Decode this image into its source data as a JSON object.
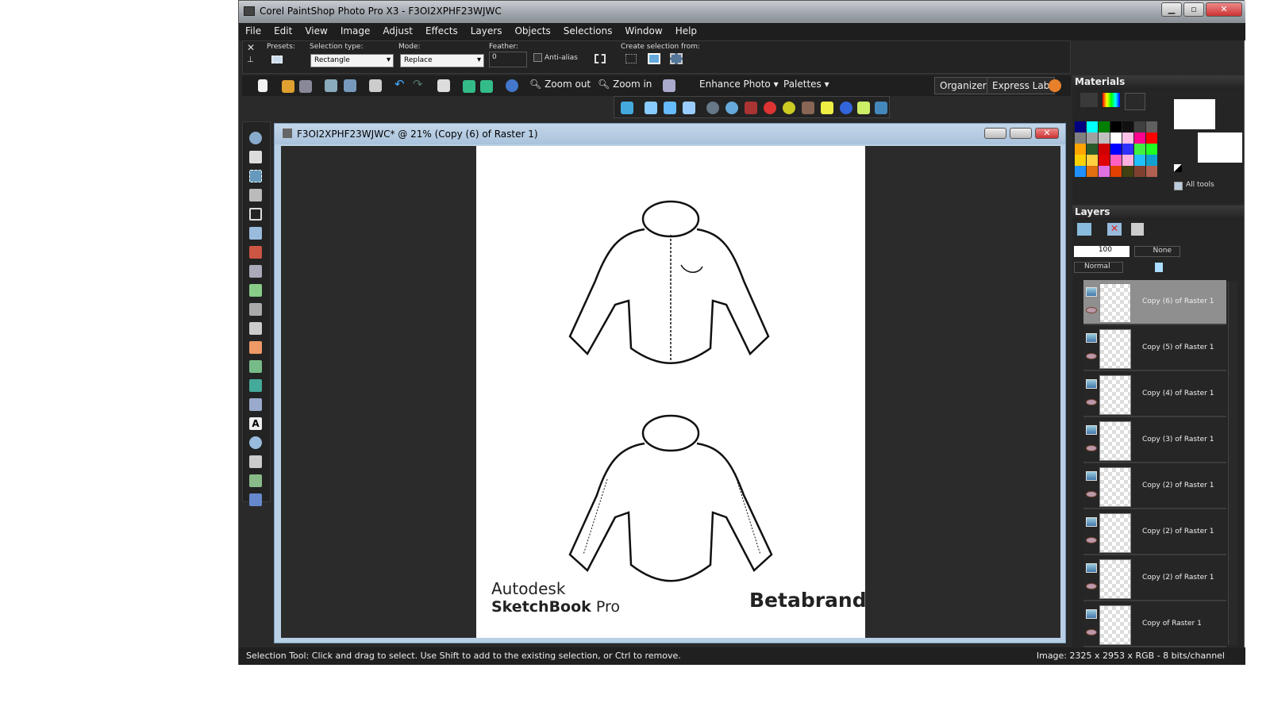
{
  "window": {
    "title": "Corel PaintShop Photo Pro X3 - F3OI2XPHF23WJWC"
  },
  "menu": [
    "File",
    "Edit",
    "View",
    "Image",
    "Adjust",
    "Effects",
    "Layers",
    "Objects",
    "Selections",
    "Window",
    "Help"
  ],
  "options": {
    "presets_label": "Presets:",
    "selection_type_label": "Selection type:",
    "selection_type": "Rectangle",
    "mode_label": "Mode:",
    "mode": "Replace",
    "feather_label": "Feather:",
    "feather": "0",
    "antialias_label": "Anti-alias",
    "antialias": false,
    "create_selection_label": "Create selection from:"
  },
  "toolbar": {
    "zoom_out": "Zoom out",
    "zoom_in": "Zoom in",
    "enhance_photo": "Enhance Photo",
    "palettes": "Palettes",
    "organizer": "Organizer",
    "express_lab": "Express Lab"
  },
  "document": {
    "title": "F3OI2XPHF23WJWC* @  21% (Copy (6) of Raster 1)",
    "logo_left_1": "Autodesk",
    "logo_left_2": "SketchBook",
    "logo_left_3": "Pro",
    "logo_right": "Betabrand"
  },
  "materials": {
    "title": "Materials",
    "all_tools_label": "All tools",
    "all_tools": true,
    "swatches": [
      "#000080",
      "#00ffff",
      "#008000",
      "#000000",
      "#111111",
      "#404040",
      "#606060",
      "#808080",
      "#a0a0a0",
      "#c0c0c0",
      "#ffffff",
      "#ffc0e8",
      "#ff0090",
      "#ff0000",
      "#ffa500",
      "#2a5a2a",
      "#d00000",
      "#0000ff",
      "#3030ff",
      "#40f040",
      "#20ff20",
      "#ffd000",
      "#ffd040",
      "#e00000",
      "#ff60c0",
      "#ffb0e0",
      "#20c0ff",
      "#10a0d0",
      "#2090ff",
      "#e07010",
      "#e070e0",
      "#e04000",
      "#404010",
      "#804030",
      "#b06050"
    ]
  },
  "layers": {
    "title": "Layers",
    "opacity": "100",
    "mask_label": "None",
    "blend_mode": "Normal",
    "items": [
      {
        "name": "Copy (6) of Raster 1",
        "active": true
      },
      {
        "name": "Copy (5) of Raster 1"
      },
      {
        "name": "Copy (4) of Raster 1"
      },
      {
        "name": "Copy (3) of Raster 1"
      },
      {
        "name": "Copy (2) of Raster 1"
      },
      {
        "name": "Copy (2) of Raster 1"
      },
      {
        "name": "Copy (2) of Raster 1"
      },
      {
        "name": "Copy of Raster 1"
      }
    ]
  },
  "status": {
    "hint": "Selection Tool: Click and drag to select. Use Shift to add to the existing selection, or Ctrl to remove.",
    "image_info": "Image:  2325 x 2953 x RGB - 8 bits/channel"
  }
}
